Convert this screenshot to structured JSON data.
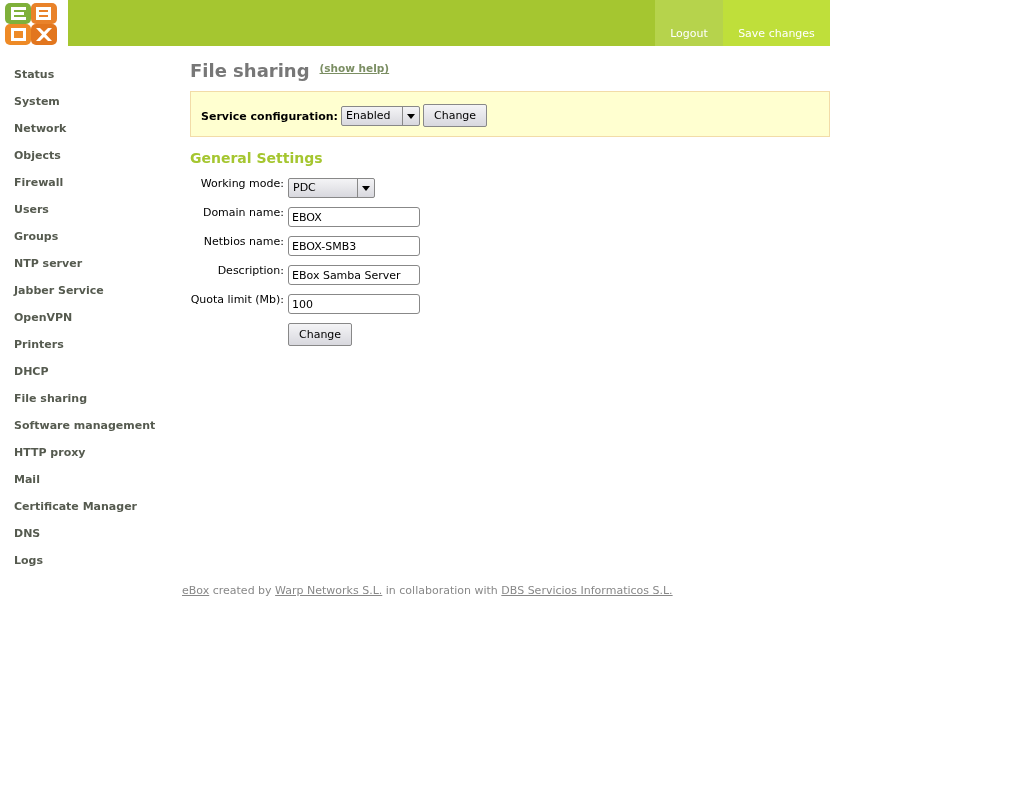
{
  "header": {
    "actions": [
      {
        "label": "Logout",
        "kind": "logout"
      },
      {
        "label": "Save changes",
        "kind": "save"
      }
    ]
  },
  "sidebar": {
    "items": [
      {
        "label": "Status"
      },
      {
        "label": "System"
      },
      {
        "label": "Network"
      },
      {
        "label": "Objects"
      },
      {
        "label": "Firewall"
      },
      {
        "label": "Users"
      },
      {
        "label": "Groups"
      },
      {
        "label": "NTP server"
      },
      {
        "label": "Jabber Service"
      },
      {
        "label": "OpenVPN"
      },
      {
        "label": "Printers"
      },
      {
        "label": "DHCP"
      },
      {
        "label": "File sharing"
      },
      {
        "label": "Software management"
      },
      {
        "label": "HTTP proxy"
      },
      {
        "label": "Mail"
      },
      {
        "label": "Certificate Manager"
      },
      {
        "label": "DNS"
      },
      {
        "label": "Logs"
      }
    ]
  },
  "page": {
    "title": "File sharing",
    "help_link": "(show help)"
  },
  "service": {
    "label": "Service configuration:",
    "value": "Enabled",
    "button": "Change"
  },
  "general_settings": {
    "title": "General Settings",
    "fields": [
      {
        "label": "Working mode:",
        "kind": "select",
        "value": "PDC"
      },
      {
        "label": "Domain name:",
        "kind": "input",
        "value": "EBOX"
      },
      {
        "label": "Netbios name:",
        "kind": "input",
        "value": "EBOX-SMB3"
      },
      {
        "label": "Description:",
        "kind": "input",
        "value": "EBox Samba Server"
      },
      {
        "label": "Quota limit (Mb):",
        "kind": "input",
        "value": "100"
      }
    ],
    "button": "Change"
  },
  "footer": {
    "parts": [
      {
        "text": "eBox",
        "kind": "link"
      },
      {
        "text": " created by ",
        "kind": "text"
      },
      {
        "text": "Warp Networks S.L.",
        "kind": "link"
      },
      {
        "text": " in collaboration with ",
        "kind": "text"
      },
      {
        "text": "DBS Servicios Informaticos S.L.",
        "kind": "link"
      }
    ]
  }
}
